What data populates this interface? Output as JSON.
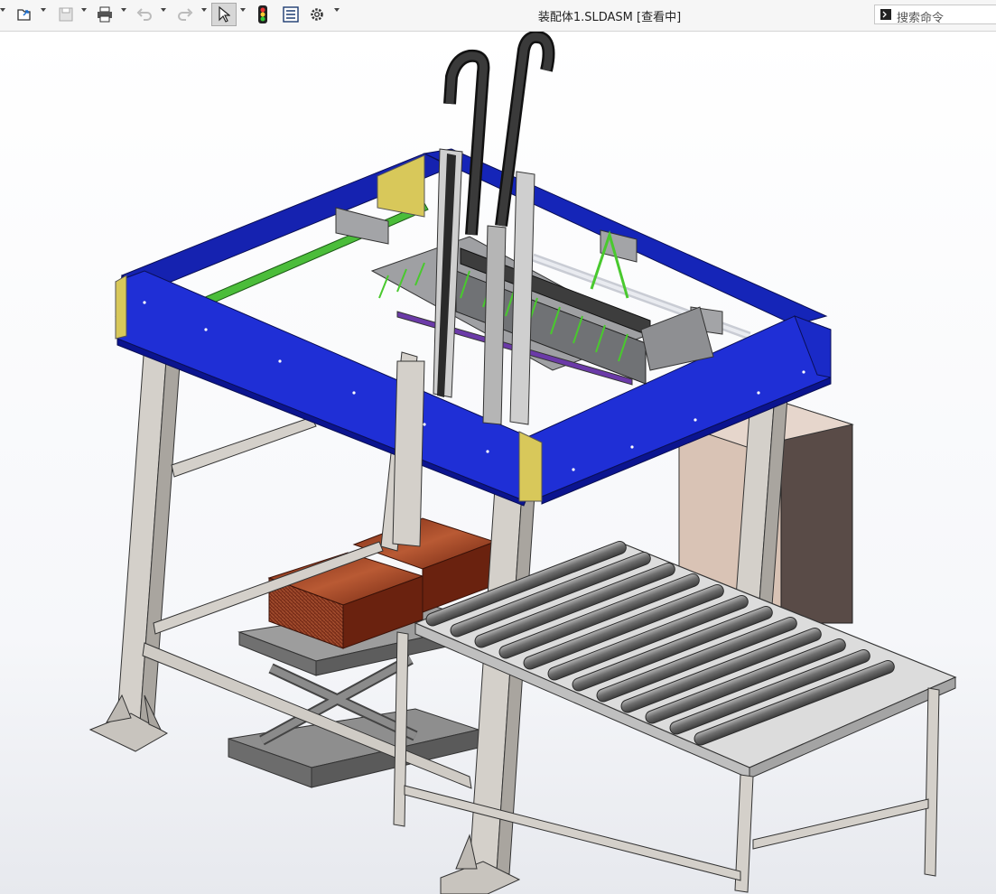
{
  "window": {
    "title": "装配体1.SLDASM [查看中]"
  },
  "search": {
    "placeholder": "搜索命令"
  },
  "toolbar": {
    "icons": [
      "new-icon",
      "open-icon",
      "save-icon",
      "print-icon",
      "undo-icon",
      "redo-icon",
      "select-icon",
      "rebuild-icon",
      "options-list-icon",
      "settings-icon"
    ]
  },
  "view_toolbar": {
    "icons": [
      "zoom-to-fit-icon",
      "zoom-to-area-icon",
      "previous-view-icon",
      "section-view-icon",
      "view-orientation-icon",
      "display-style-icon",
      "hide-show-items-icon",
      "edit-appearance-icon",
      "apply-scene-icon",
      "view-settings-icon"
    ]
  },
  "colors": {
    "frame_blue": "#1f2fd6",
    "frame_dark_blue": "#0b148f",
    "corner_yellow": "#d8c85a",
    "column_grey": "#d3d0cb",
    "wood_red": "#9c3f22",
    "roller_grey": "#7c7c7c",
    "cabinet_pink": "#d8c2b5",
    "cabinet_dark": "#5a4c48",
    "rail_green": "#49b938"
  }
}
